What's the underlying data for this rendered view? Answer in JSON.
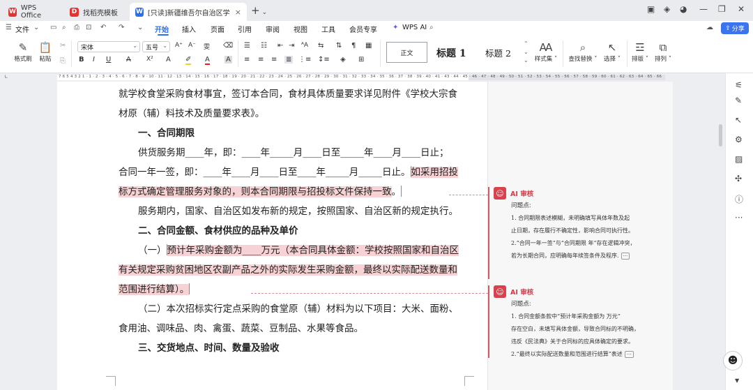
{
  "tabs": [
    {
      "label": "WPS Office",
      "icon": "wps-logo-icon",
      "color": "#e8322f"
    },
    {
      "label": "找稻壳模板",
      "icon": "docer-icon",
      "color": "#e8322f"
    },
    {
      "label": "[只读]新疆维吾尔自治区学校食",
      "icon": "word-doc-icon",
      "color": "#2c6fe8"
    }
  ],
  "menu": {
    "file": "文件",
    "items": [
      "开始",
      "插入",
      "页面",
      "引用",
      "审阅",
      "视图",
      "工具",
      "会员专享"
    ],
    "active": "开始",
    "wps_ai": "WPS AI",
    "share": "分享"
  },
  "ribbon": {
    "format_painter": "格式刷",
    "paste": "粘贴",
    "font_name": "宋体",
    "font_size": "五号",
    "style_normal": "正文",
    "style_h1": "标题 1",
    "style_h2": "标题 2",
    "style_set": "样式集",
    "find_replace": "查找替换",
    "select": "选择",
    "layout": "排版",
    "arrange": "排列"
  },
  "ruler": "7 6 5 4 3 2 1 · 1 · 2 · 3 · 4 · 5 · 6 · 7 · 8 · 9 · 10 · 11 · 12 · 13 · 14 · 15 · 16 · 17 · 18 · 19 · 20 · 21 · 22 · 23 · 24 · 25 · 26 · 27 · 28 · 29 · 30 · 31 · 32 · 33 · 34 · 35 · 36 · 37 · 38 · 39 · 40 · 41 · 43 · 44 · 45 · 46 · 47 · 48 · 49 · 50 · 51 · 52 · 53 · 54 · 55 · 56 · 57 · 58 · 59 · 60 · 61 · 62 · 63 · 64 · 65 · 66",
  "doc": {
    "l1": "就学校食堂采购食材事宜，签订本合同，食材具体质量要求详见附件《学校大宗食",
    "l2": "材原（辅）料技术及质量要求表》。",
    "h1": "一、合同期限",
    "l3": "供货服务期____年，即：____年_____月____日至_____年____月____日止；",
    "l4a": "合同一年一签，即：____年____月____日至____年_____月_____日止。",
    "l4b": "如采用招投",
    "l5": "标方式确定管理服务对象的，则本合同期限与招投标文件保持一致",
    "l5b": "。",
    "l6": "服务期内，国家、自治区如发布新的规定，按照国家、自治区新的规定执行。",
    "h2": "二、合同金额、食材供应的品种及单价",
    "l7a": "（一）",
    "l7b": "预计年采购金额为____万元（本合同具体金额：学校按照国家和自治区",
    "l8": "有关规定采购贫困地区农副产品之外的实际发生采购金额，最终以实际配送数量和",
    "l9": "范围进行结算）。",
    "l10": "（二）本次招标实行定点采购的食堂原（辅）材料为以下项目：大米、面粉、",
    "l11": "食用油、调味品、肉、禽蛋、蔬菜、豆制品、水果等食品。",
    "h3": "三、交货地点、时间、数量及验收"
  },
  "ai_cards": [
    {
      "title": "AI 审核",
      "subtitle": "问题点:",
      "lines": [
        "1. 合同期限表述模糊，未明确填写具体年数及起",
        "止日期，存在履行不确定性，影响合同可执行性。",
        "2.“合同一年一签”与“合同期限 年”存在逻辑冲突，",
        "若为长期合同，应明确每年续签条件及程序."
      ],
      "more": "···"
    },
    {
      "title": "AI 审核",
      "subtitle": "问题点:",
      "lines": [
        "1. 合同金额条款中“预计年采购金额为      万元”",
        "存在空白，未填写具体金额，导致合同标的不明确，",
        "违反《民法典》关于合同标的应具体确定的要求。",
        "2.“最终以实际配送数量和范围进行结算”表述"
      ],
      "more": "···"
    }
  ]
}
